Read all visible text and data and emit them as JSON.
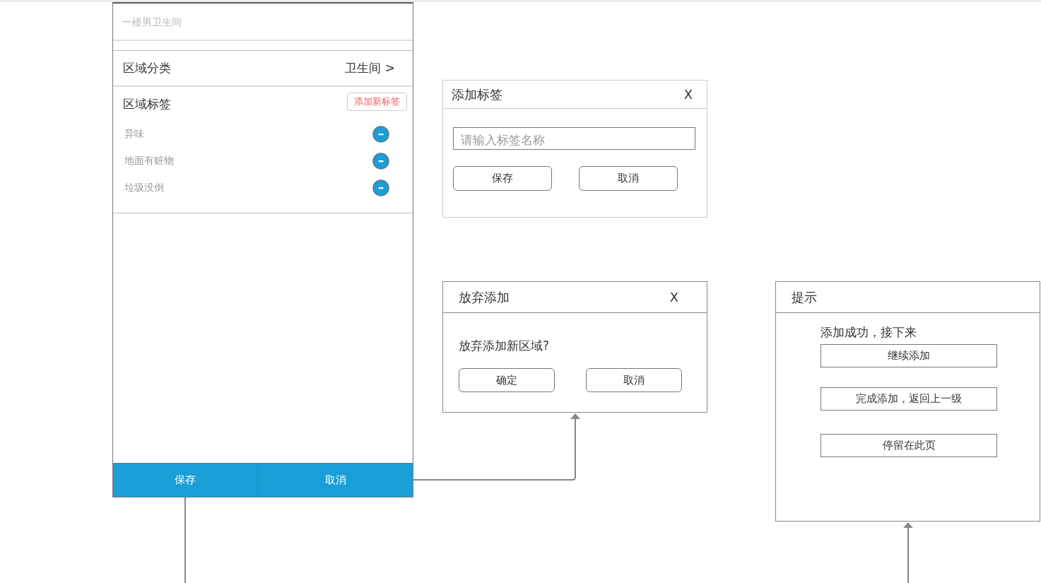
{
  "area_form": {
    "name_field": {
      "placeholder": "一楼男卫生间"
    },
    "category": {
      "label": "区域分类",
      "value": "卫生间 >"
    },
    "tags": {
      "label": "区域标签",
      "add_button": "添加新标签",
      "items": [
        {
          "name": "异味"
        },
        {
          "name": "地面有赃物"
        },
        {
          "name": "垃圾没倒"
        }
      ]
    },
    "buttons": [
      "保存",
      "取消"
    ]
  },
  "add_tag_dialog": {
    "title": "添加标签",
    "close": "X",
    "input": {
      "placeholder": "请输入标签名称"
    },
    "buttons": [
      "保存",
      "取消"
    ]
  },
  "discard_dialog": {
    "title": "放弃添加",
    "close": "X",
    "message": "放弃添加新区域?",
    "buttons": [
      "确定",
      "取消"
    ]
  },
  "tip_dialog": {
    "title": "提示",
    "message": "添加成功，接下来",
    "options": [
      "继续添加",
      "完成添加，返回上一级",
      "停留在此页"
    ]
  }
}
